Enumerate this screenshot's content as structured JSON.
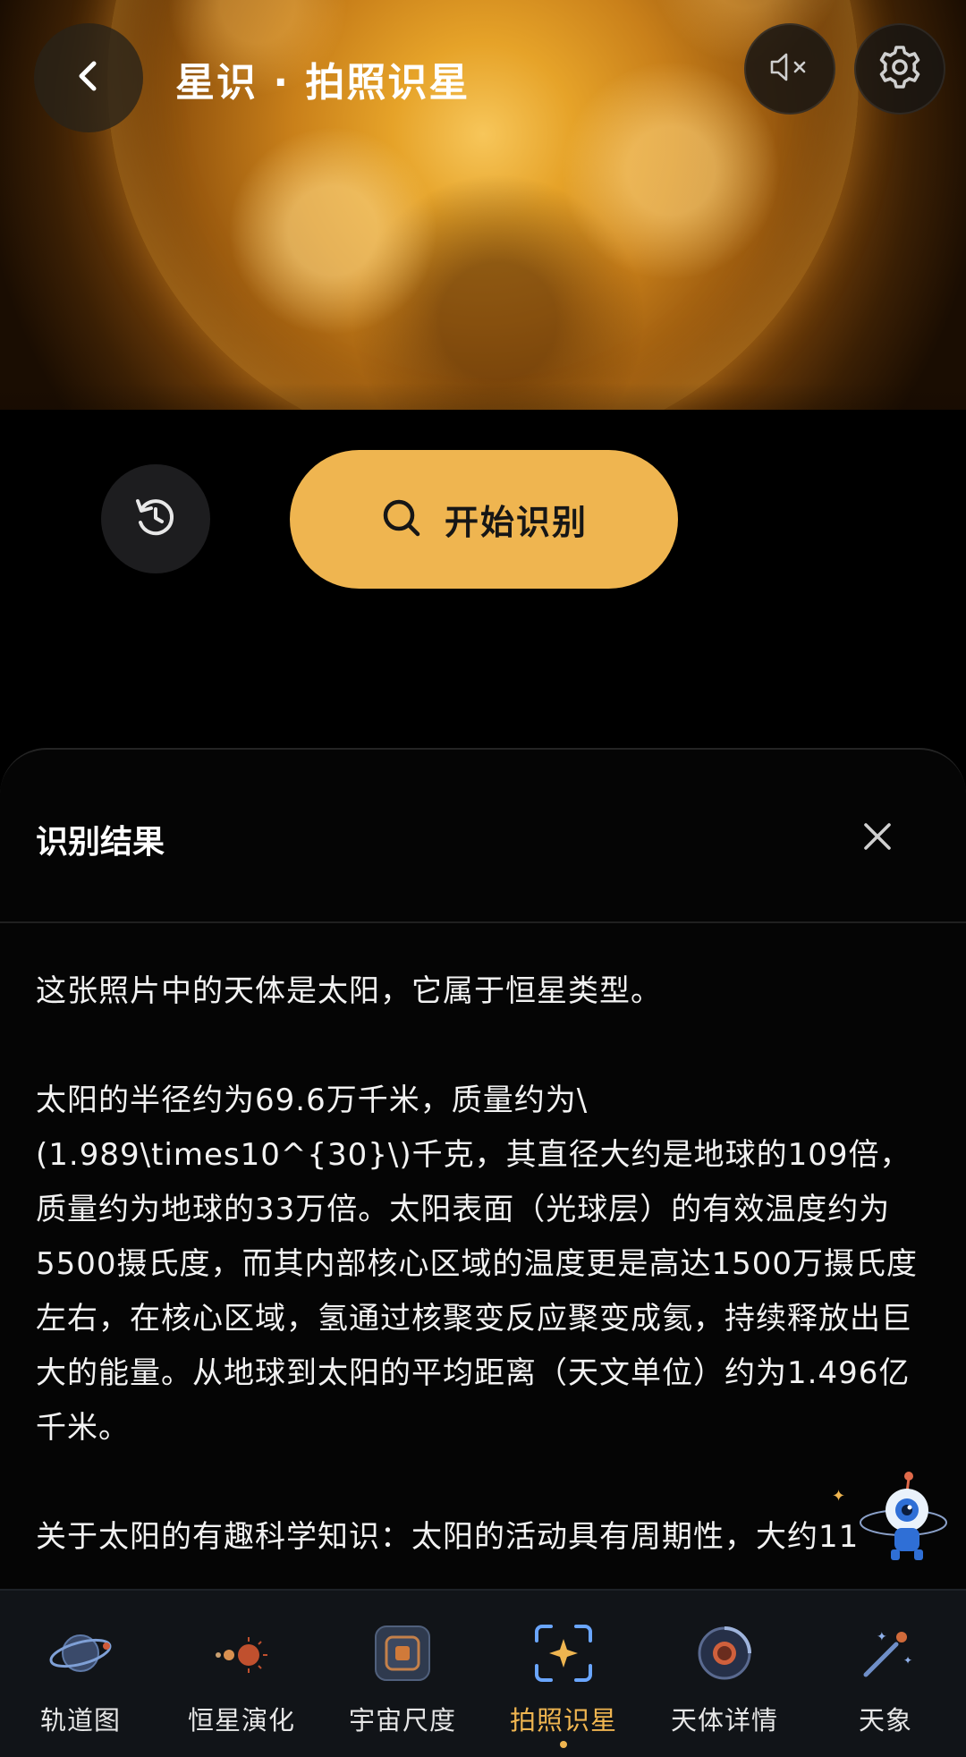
{
  "header": {
    "title": "星识 · 拍照识星"
  },
  "actions": {
    "start_label": "开始识别"
  },
  "result": {
    "title": "识别结果",
    "paragraphs": [
      "这张照片中的天体是太阳，它属于恒星类型。",
      "太阳的半径约为69.6万千米，质量约为\\(1.989\\times10^{30}\\)千克，其直径大约是地球的109倍，质量约为地球的33万倍。太阳表面（光球层）的有效温度约为5500摄氏度，而其内部核心区域的温度更是高达1500万摄氏度左右，在核心区域，氢通过核聚变反应聚变成氦，持续释放出巨大的能量。从地球到太阳的平均距离（天文单位）约为1.496亿千米。",
      "关于太阳的有趣科学知识：太阳的活动具有周期性，大约11"
    ]
  },
  "nav": {
    "items": [
      {
        "label": "轨道图",
        "icon": "orbit-icon"
      },
      {
        "label": "恒星演化",
        "icon": "star-evolution-icon"
      },
      {
        "label": "宇宙尺度",
        "icon": "cosmic-scale-icon"
      },
      {
        "label": "拍照识星",
        "icon": "photo-identify-icon"
      },
      {
        "label": "天体详情",
        "icon": "celestial-detail-icon"
      },
      {
        "label": "天象",
        "icon": "astronomical-event-icon"
      }
    ],
    "active_index": 3
  },
  "colors": {
    "accent": "#efb550",
    "background": "#000000",
    "nav_background": "#111418"
  }
}
